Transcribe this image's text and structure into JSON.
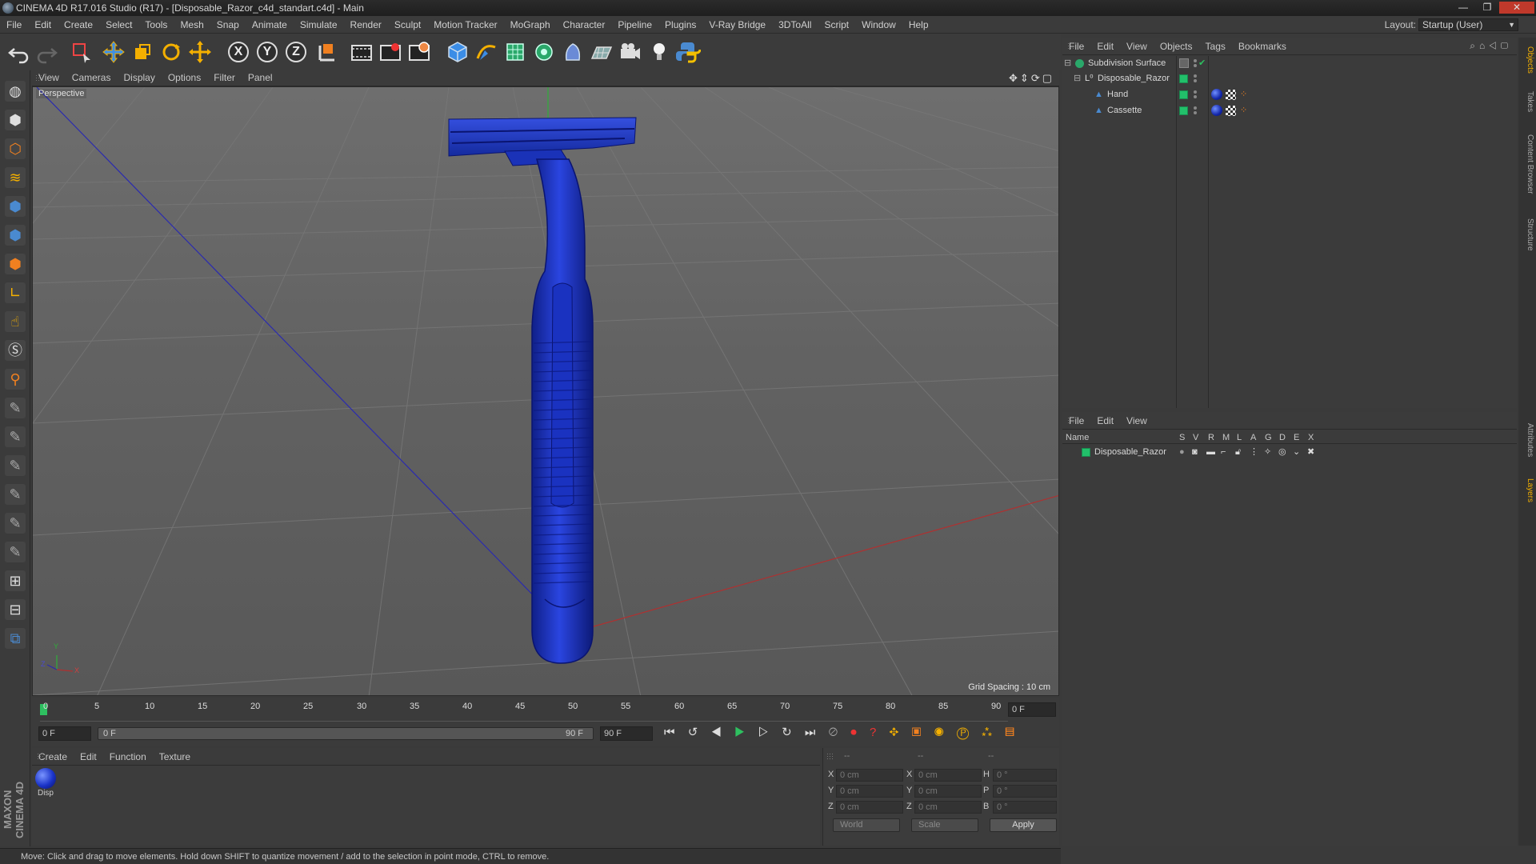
{
  "window": {
    "title": "CINEMA 4D R17.016 Studio (R17) - [Disposable_Razor_c4d_standart.c4d] - Main",
    "controls": [
      "—",
      "❐",
      "✕"
    ]
  },
  "menubar": {
    "items": [
      "File",
      "Edit",
      "Create",
      "Select",
      "Tools",
      "Mesh",
      "Snap",
      "Animate",
      "Simulate",
      "Render",
      "Sculpt",
      "Motion Tracker",
      "MoGraph",
      "Character",
      "Pipeline",
      "Plugins",
      "V-Ray Bridge",
      "3DToAll",
      "Script",
      "Window",
      "Help"
    ],
    "layout_label": "Layout:",
    "layout_value": "Startup (User)"
  },
  "toolbar": {
    "icons": [
      "undo-icon",
      "redo-icon",
      "live-selection-icon",
      "move-icon",
      "scale-icon",
      "rotate-icon",
      "transform-icon",
      "x-axis-icon",
      "y-axis-icon",
      "z-axis-icon",
      "coordinate-system-icon",
      "render-view-icon",
      "render-picture-viewer-icon",
      "edit-render-settings-icon",
      "cube-icon",
      "pen-spline-icon",
      "subdivision-icon",
      "cloner-icon",
      "deformer-icon",
      "floor-icon",
      "camera-icon",
      "light-icon",
      "python-icon"
    ],
    "axis_labels": [
      "X",
      "Y",
      "Z"
    ]
  },
  "left_tools": [
    "make-editable-icon",
    "model-mode-icon",
    "texture-mode-icon",
    "workplane-icon",
    "points-mode-icon",
    "edges-mode-icon",
    "polygons-mode-icon",
    "enable-axis-icon",
    "tweak-icon",
    "solo-icon",
    "snap-icon",
    "brush-icon",
    "sculpt-pull-icon",
    "sculpt-smooth-icon",
    "sculpt-inflate-icon",
    "sculpt-flatten-icon",
    "sculpt-grab-icon",
    "lock-workplane-icon",
    "planar-workplane-icon",
    "python-script-icon"
  ],
  "viewport": {
    "menu": [
      "View",
      "Cameras",
      "Display",
      "Options",
      "Filter",
      "Panel"
    ],
    "camera_label": "Perspective",
    "grid_spacing": "Grid Spacing : 10 cm",
    "axis_gizmo": {
      "y": "Y",
      "z": "Z",
      "x": "X"
    }
  },
  "timeline": {
    "ticks": [
      "0",
      "5",
      "10",
      "15",
      "20",
      "25",
      "30",
      "35",
      "40",
      "45",
      "50",
      "55",
      "60",
      "65",
      "70",
      "75",
      "80",
      "85",
      "90"
    ],
    "current_frame_field": "0 F",
    "start_field": "0 F",
    "range_start": "0 F",
    "range_end": "90 F",
    "end_field": "90 F"
  },
  "material_manager": {
    "menu": [
      "Create",
      "Edit",
      "Function",
      "Texture"
    ],
    "materials": [
      {
        "name": "Disp",
        "color": "#1a33c8"
      }
    ]
  },
  "coordinates": {
    "headers": [
      "--",
      "--",
      "--"
    ],
    "rows": [
      {
        "a_label": "X",
        "a_value": "0 cm",
        "b_label": "X",
        "b_value": "0 cm",
        "c_label": "H",
        "c_value": "0 °"
      },
      {
        "a_label": "Y",
        "a_value": "0 cm",
        "b_label": "Y",
        "b_value": "0 cm",
        "c_label": "P",
        "c_value": "0 °"
      },
      {
        "a_label": "Z",
        "a_value": "0 cm",
        "b_label": "Z",
        "b_value": "0 cm",
        "c_label": "B",
        "c_value": "0 °"
      }
    ],
    "space_select": "World",
    "mode_select": "Scale",
    "apply_label": "Apply"
  },
  "status_bar": {
    "text": "Move: Click and drag to move elements. Hold down SHIFT to quantize movement / add to the selection in point mode, CTRL to remove."
  },
  "object_manager": {
    "menu": [
      "File",
      "Edit",
      "View",
      "Objects",
      "Tags",
      "Bookmarks"
    ],
    "objects": [
      {
        "name": "Subdivision Surface",
        "indent": 0
      },
      {
        "name": "Disposable_Razor",
        "indent": 1
      },
      {
        "name": "Hand",
        "indent": 2
      },
      {
        "name": "Cassette",
        "indent": 2
      }
    ]
  },
  "layer_manager": {
    "menu": [
      "File",
      "Edit",
      "View"
    ],
    "columns": [
      "Name",
      "S",
      "V",
      "R",
      "M",
      "L",
      "A",
      "G",
      "D",
      "E",
      "X"
    ],
    "layers": [
      {
        "name": "Disposable_Razor",
        "color": "#22c06a"
      }
    ]
  },
  "side_tabs": [
    "Objects",
    "Takes",
    "Content Browser",
    "Structure",
    "Attributes",
    "Layers"
  ],
  "branding": "MAXON CINEMA 4D",
  "colors": {
    "razor_blue": "#1a2fc0",
    "accent_green": "#22c06a",
    "x_axis_red": "#b03030",
    "z_axis_blue": "#2a2ab0",
    "y_axis_green": "#2fae3a"
  }
}
